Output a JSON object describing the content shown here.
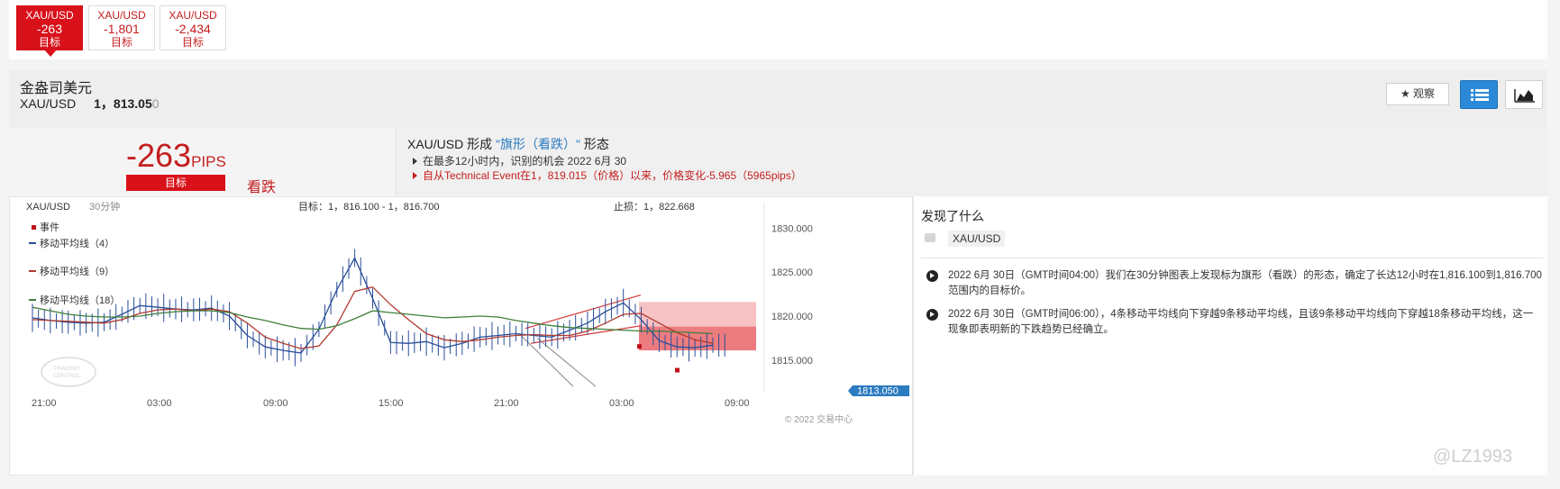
{
  "tabs": [
    {
      "symbol": "XAU/USD",
      "value": "-263",
      "label": "目标",
      "active": true
    },
    {
      "symbol": "XAU/USD",
      "value": "-1,801",
      "label": "目标",
      "active": false
    },
    {
      "symbol": "XAU/USD",
      "value": "-2,434",
      "label": "目标",
      "active": false
    }
  ],
  "header": {
    "name": "金盎司美元",
    "symbol": "XAU/USD",
    "price_main": "1，813.05",
    "price_last": "0",
    "watch_label": "观察"
  },
  "summary": {
    "pips_value": "-263",
    "pips_unit": "PIPS",
    "target_label": "目标",
    "direction": "看跌",
    "title_prefix": "XAU/USD 形成 ",
    "pattern": "\"旗形（看跌）\"",
    "title_suffix": " 形态",
    "line1": "在最多12小时内，识别的机会 2022 6月 30",
    "line2": "自从Technical Event在1，819.015（价格）以来，价格变化-5.965（5965pips）"
  },
  "chart": {
    "symbol": "XAU/USD",
    "interval": "30分钟",
    "target_text": "目标：1，816.100 - 1，816.700",
    "stop_text": "止损：1，822.668",
    "legend": [
      "事件",
      "移动平均线（4）",
      "移动平均线（9）",
      "移动平均线（18）"
    ],
    "logo_text_1": "TRADING",
    "logo_text_2": "CENTRAL",
    "copyright": "© 2022 交易中心",
    "current_price": "1813.050",
    "colors": {
      "ma4": "#2a4f9a",
      "ma9": "#b03a2e",
      "ma18": "#3f7f3a",
      "bar": "#2a4f9a",
      "event": "#c0111a",
      "target": "#f4a8aa"
    }
  },
  "chart_data": {
    "type": "line",
    "x_ticks": [
      "21:00",
      "03:00",
      "09:00",
      "15:00",
      "21:00",
      "03:00",
      "09:00"
    ],
    "y_ticks": [
      "1830.000",
      "1825.000",
      "1820.000",
      "1815.000"
    ],
    "ylim": [
      1811.5,
      1833
    ],
    "series": [
      {
        "name": "移动平均线（4）",
        "values": [
          1819.8,
          1819.5,
          1819.3,
          1819.2,
          1819.3,
          1820.2,
          1821.2,
          1821.0,
          1820.8,
          1820.7,
          1820.9,
          1820.0,
          1817.8,
          1816.5,
          1816.1,
          1815.8,
          1818.5,
          1823.0,
          1826.6,
          1822.0,
          1817.0,
          1816.9,
          1817.1,
          1816.4,
          1816.9,
          1817.6,
          1817.8,
          1818.0,
          1817.8,
          1817.6,
          1818.4,
          1819.2,
          1820.5,
          1821.5,
          1819.6,
          1817.2,
          1816.5,
          1816.4,
          1816.7
        ]
      },
      {
        "name": "移动平均线（9）",
        "values": [
          1819.6,
          1819.5,
          1819.4,
          1819.3,
          1819.2,
          1819.6,
          1820.3,
          1820.7,
          1820.8,
          1820.6,
          1820.8,
          1820.5,
          1819.2,
          1817.6,
          1816.9,
          1816.3,
          1816.6,
          1819.0,
          1822.8,
          1823.3,
          1821.3,
          1819.6,
          1818.0,
          1817.3,
          1817.1,
          1817.3,
          1817.6,
          1817.8,
          1817.9,
          1817.8,
          1817.8,
          1818.3,
          1819.2,
          1820.2,
          1820.3,
          1819.2,
          1818.1,
          1817.3,
          1816.9
        ]
      },
      {
        "name": "移动平均线（18）",
        "values": [
          1821.0,
          1820.6,
          1820.2,
          1820.0,
          1819.9,
          1819.9,
          1820.0,
          1820.3,
          1820.5,
          1820.6,
          1820.6,
          1820.4,
          1819.9,
          1819.5,
          1819.0,
          1818.6,
          1818.5,
          1818.9,
          1819.7,
          1820.6,
          1820.4,
          1820.2,
          1820.0,
          1819.8,
          1819.9,
          1820.0,
          1819.9,
          1819.5,
          1819.2,
          1818.9,
          1818.7,
          1818.6,
          1818.5,
          1818.4,
          1818.3,
          1818.3,
          1818.2,
          1818.1,
          1818.0
        ]
      }
    ],
    "target_zone": [
      1816.1,
      1818.8
    ],
    "stop": 1822.668,
    "current_price": 1813.05,
    "legend": "top-left",
    "grid": false
  },
  "right": {
    "title": "发现了什么",
    "tag": "XAU/USD",
    "items": [
      "2022 6月 30日（GMT时间04:00）我们在30分钟图表上发现标为旗形（看跌）的形态，确定了长达12小时在1,816.100到1,816.700范围内的目标价。",
      "2022 6月 30日（GMT时间06:00），4条移动平均线向下穿越9条移动平均线，且该9条移动平均线向下穿越18条移动平均线，这一现象即表明新的下跌趋势已经确立。"
    ]
  },
  "watermark": "@LZ1993"
}
